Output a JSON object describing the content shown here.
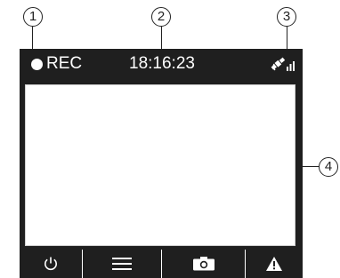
{
  "callouts": [
    "1",
    "2",
    "3",
    "4"
  ],
  "status_bar": {
    "record_indicator_icon": "filled-circle",
    "record_label": "REC",
    "clock": "18:16:23",
    "gps_signal_icon": "satellite-signal"
  },
  "toolbar": {
    "buttons": [
      {
        "icon": "power-icon"
      },
      {
        "icon": "menu-icon"
      },
      {
        "icon": "camera-icon"
      },
      {
        "icon": "warning-icon"
      }
    ]
  },
  "colors": {
    "device_bezel": "#1f1f1f",
    "screen_background": "#ffffff",
    "foreground": "#ffffff"
  }
}
